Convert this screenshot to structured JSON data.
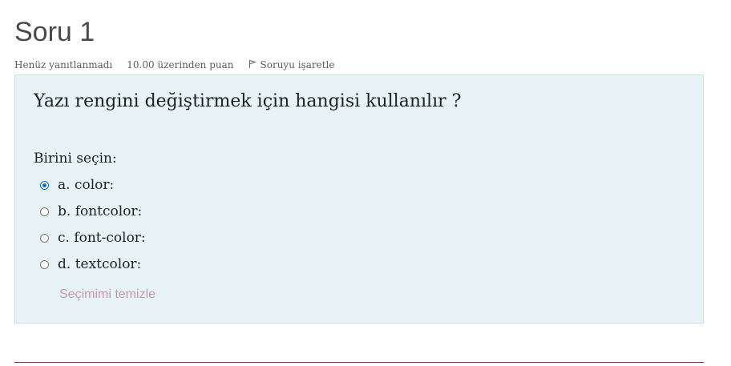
{
  "question": {
    "title": "Soru 1",
    "status": "Henüz yanıtlanmadı",
    "points": "10.00 üzerinden puan",
    "flag_label": "Soruyu işaretle",
    "text": "Yazı rengini değiştirmek için hangisi kullanılır ?",
    "prompt": "Birini seçin:",
    "options": [
      {
        "label": "a. color:",
        "selected": true
      },
      {
        "label": "b. fontcolor:",
        "selected": false
      },
      {
        "label": "c. font-color:",
        "selected": false
      },
      {
        "label": "d. textcolor:",
        "selected": false
      }
    ],
    "clear_label": "Seçimimi temizle"
  },
  "colors": {
    "box_bg": "#e7f3f5",
    "accent": "#0f6cbf",
    "clear_link": "#c39ab3"
  }
}
